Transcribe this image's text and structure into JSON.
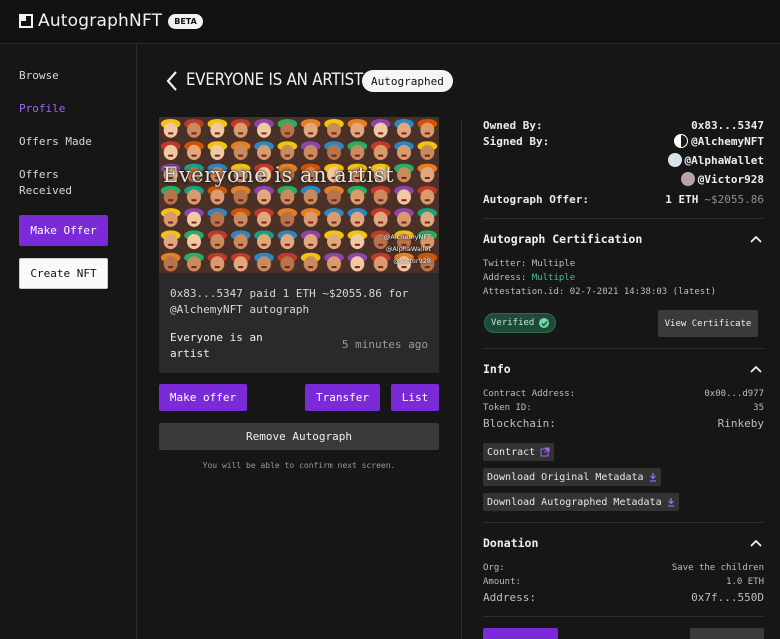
{
  "header": {
    "app_name": "AutographNFT",
    "badge": "BETA"
  },
  "sidebar": {
    "links": [
      "Browse",
      "Profile",
      "Offers Made",
      "Offers Received"
    ],
    "offers_received_line1": "Offers",
    "offers_received_line2": "Received",
    "make_offer": "Make Offer",
    "create_nft": "Create NFT"
  },
  "page": {
    "title": "EVERYONE IS AN ARTIST",
    "status_pill": "Autographed"
  },
  "card": {
    "art_title": "Everyone is an artist",
    "signatures": [
      "@AlchemyNFT",
      "@AlphaWallet",
      "@Victor928"
    ],
    "text_line1": "0x83...5347 paid 1 ETH ~$2055.86 for",
    "text_line2": "@AlchemyNFT autograph",
    "name_line1": "Everyone is an",
    "name_line2": "artist",
    "time": "5 minutes ago"
  },
  "actions": {
    "make_offer": "Make offer",
    "transfer": "Transfer",
    "list": "List",
    "remove_autograph": "Remove Autograph",
    "confirm_note": "You will be able to confirm next screen."
  },
  "ownership": {
    "owned_by_label": "Owned By:",
    "owned_by_value": "0x83...5347",
    "signed_by_label": "Signed By:",
    "signers": [
      "@AlchemyNFT",
      "@AlphaWallet",
      "@Victor928"
    ],
    "offer_label": "Autograph Offer:",
    "offer_eth": "1 ETH",
    "offer_usd": "~$2055.86"
  },
  "certification": {
    "title": "Autograph Certification",
    "twitter_label": "Twitter:",
    "twitter_value": "Multiple",
    "address_label": "Address:",
    "address_value": "Multiple",
    "attestation": "Attestation.id: 02-7-2021 14:38:03 (latest)",
    "verified": "Verified",
    "view_certificate": "View Certificate"
  },
  "info": {
    "title": "Info",
    "contract_address_label": "Contract Address:",
    "contract_address_value": "0x00...d977",
    "token_id_label": "Token ID:",
    "token_id_value": "35",
    "blockchain_label": "Blockchain:",
    "blockchain_value": "Rinkeby",
    "contract_link": "Contract",
    "download_original": "Download Original Metadata",
    "download_autographed": "Download Autographed Metadata"
  },
  "donation": {
    "title": "Donation",
    "org_label": "Org:",
    "org_value": "Save the children",
    "amount_label": "Amount:",
    "amount_value": "1.0 ETH",
    "address_label": "Address:",
    "address_value": "0x7f...550D"
  },
  "colors": {
    "accent": "#7b2ad8",
    "active_link": "#9a6cf0",
    "verified_green": "#4fbf86"
  }
}
